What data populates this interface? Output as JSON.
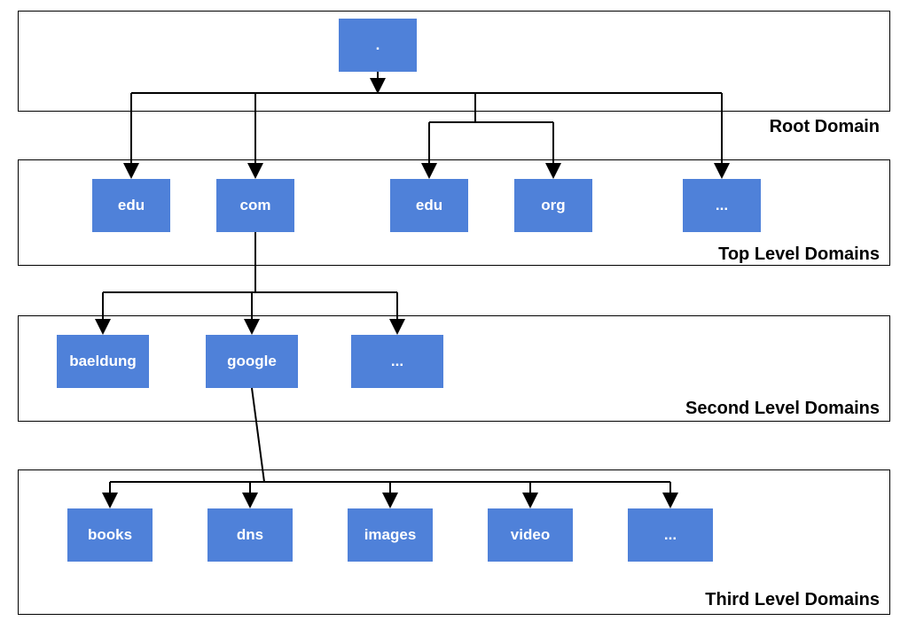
{
  "levels": {
    "root": {
      "label": "Root Domain"
    },
    "tld": {
      "label": "Top Level Domains"
    },
    "sld": {
      "label": "Second Level Domains"
    },
    "third": {
      "label": "Third Level Domains"
    }
  },
  "nodes": {
    "root": ".",
    "tld": [
      "edu",
      "com",
      "edu",
      "org",
      "..."
    ],
    "sld": [
      "baeldung",
      "google",
      "..."
    ],
    "third": [
      "books",
      "dns",
      "images",
      "video",
      "..."
    ]
  },
  "colors": {
    "node_bg": "#4f81d9",
    "node_text": "#ffffff",
    "frame_border": "#000000"
  }
}
